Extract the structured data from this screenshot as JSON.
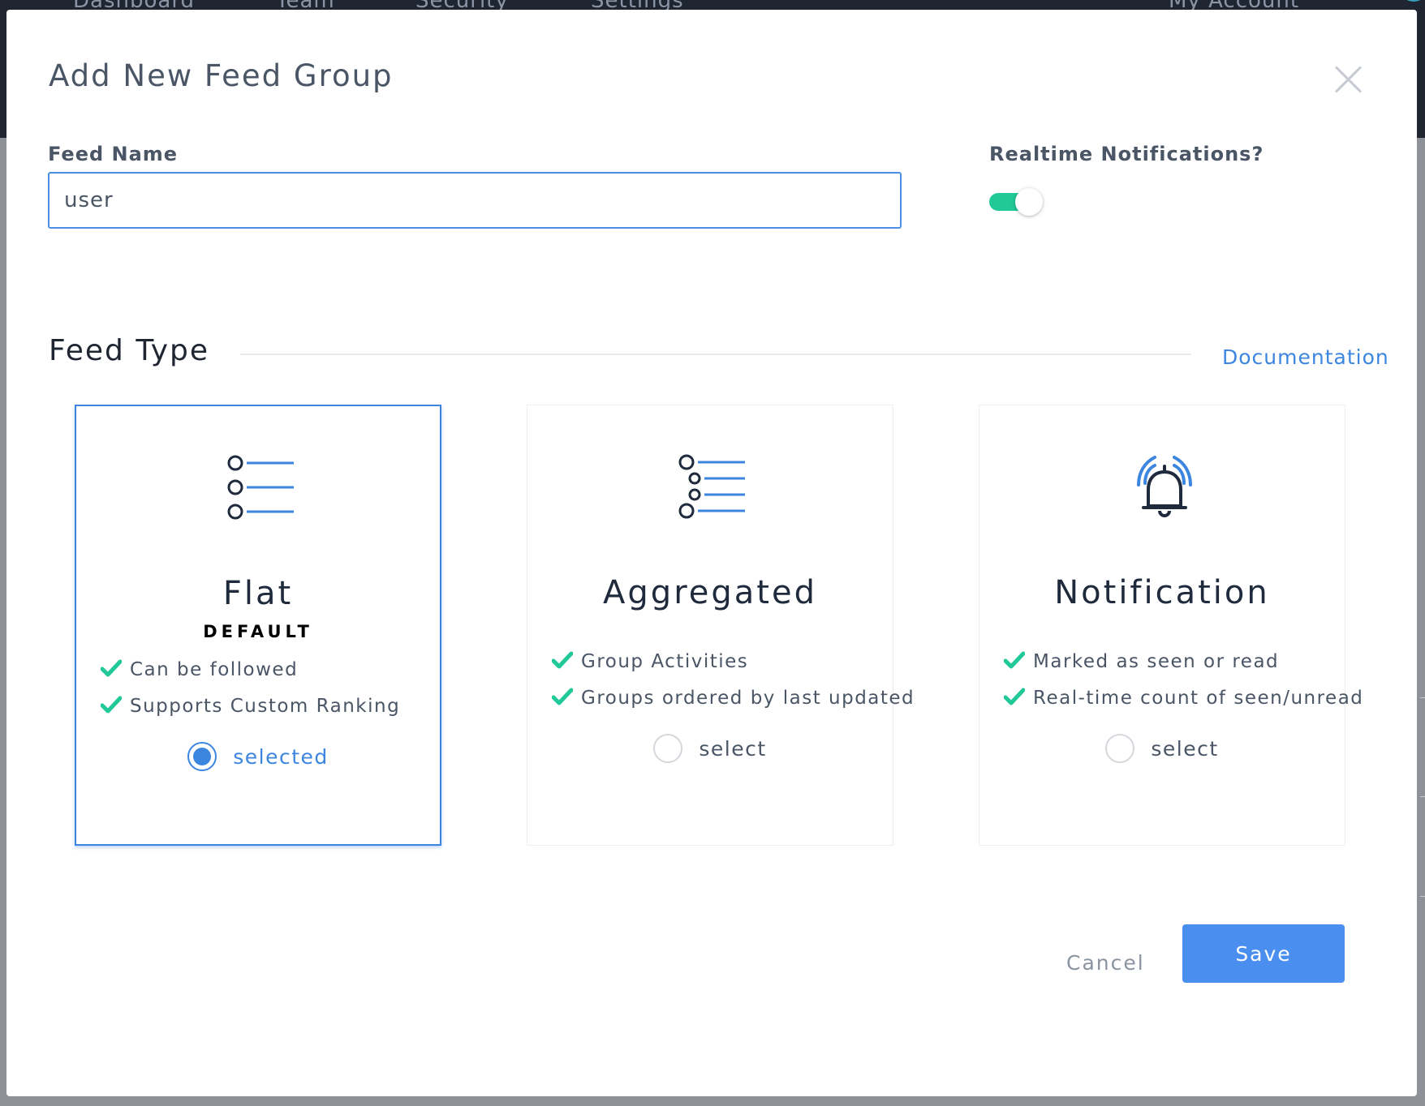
{
  "background_nav": {
    "items": [
      "Dashboard",
      "Team",
      "Security",
      "Settings"
    ],
    "account": "My Account"
  },
  "modal": {
    "title": "Add New Feed Group",
    "close_icon": "close-icon"
  },
  "feed_name": {
    "label": "Feed Name",
    "value": "user"
  },
  "realtime": {
    "label": "Realtime Notifications?",
    "enabled": true
  },
  "feed_type": {
    "title": "Feed Type",
    "documentation_link": "Documentation",
    "cards": [
      {
        "icon": "flat-list-icon",
        "title": "Flat",
        "subtitle": "DEFAULT",
        "features": [
          "Can be followed",
          "Supports Custom Ranking"
        ],
        "radio_label": "selected",
        "selected": true
      },
      {
        "icon": "aggregated-list-icon",
        "title": "Aggregated",
        "subtitle": "",
        "features": [
          "Group Activities",
          "Groups ordered by last updated"
        ],
        "radio_label": "select",
        "selected": false
      },
      {
        "icon": "bell-icon",
        "title": "Notification",
        "subtitle": "",
        "features": [
          "Marked as seen or read",
          "Real-time count of seen/unread"
        ],
        "radio_label": "select",
        "selected": false
      }
    ]
  },
  "actions": {
    "cancel": "Cancel",
    "save": "Save"
  },
  "colors": {
    "accent": "#3c86e0",
    "toggle_on": "#20c997",
    "check": "#20c997",
    "save_button": "#4a8ff0"
  }
}
